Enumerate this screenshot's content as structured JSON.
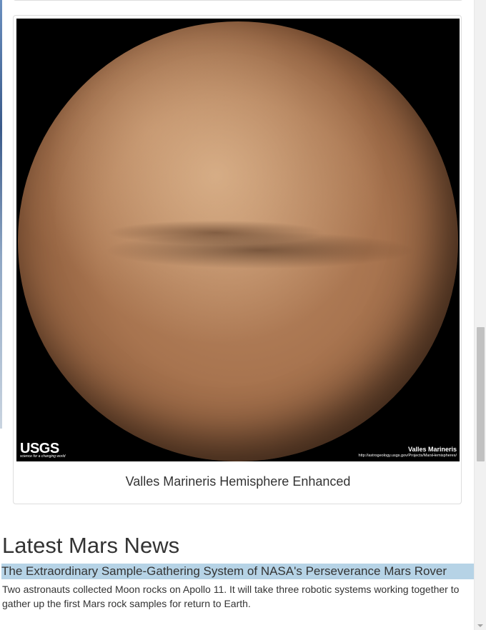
{
  "hemisphere": {
    "caption": "Valles Marineris Hemisphere Enhanced",
    "image": {
      "logo_text": "USGS",
      "logo_tagline": "science for a changing world",
      "label_title": "Valles Marineris",
      "label_url": "http://astrogeology.usgs.gov/Projects/MarsHemispheres/"
    }
  },
  "news": {
    "heading": "Latest Mars News",
    "title": "The Extraordinary Sample-Gathering System of NASA's Perseverance Mars Rover",
    "teaser": "Two astronauts collected Moon rocks on Apollo 11. It will take three robotic systems working together to gather up the first Mars rock samples for return to Earth."
  },
  "colors": {
    "selection_highlight": "#b6d3e6",
    "text": "#333333",
    "card_border": "#dddddd"
  }
}
